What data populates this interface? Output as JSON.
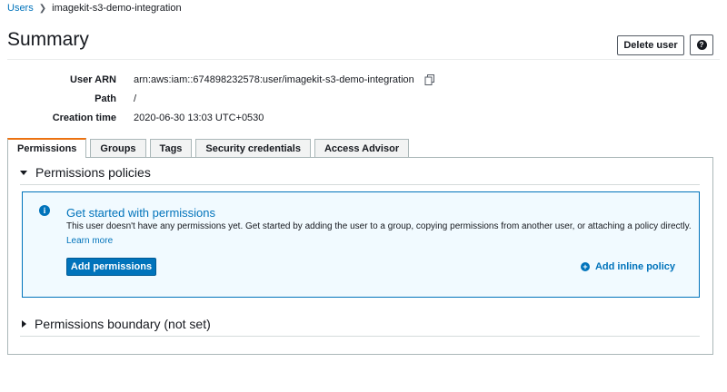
{
  "breadcrumb": {
    "parent": "Users",
    "current": "imagekit-s3-demo-integration"
  },
  "header": {
    "title": "Summary",
    "delete_label": "Delete user",
    "help_glyph": "?"
  },
  "details": {
    "arn_label": "User ARN",
    "arn_value": "arn:aws:iam::674898232578:user/imagekit-s3-demo-integration",
    "path_label": "Path",
    "path_value": "/",
    "created_label": "Creation time",
    "created_value": "2020-06-30 13:03 UTC+0530"
  },
  "tabs": [
    {
      "label": "Permissions",
      "active": true
    },
    {
      "label": "Groups"
    },
    {
      "label": "Tags"
    },
    {
      "label": "Security credentials"
    },
    {
      "label": "Access Advisor"
    }
  ],
  "permissions": {
    "policies_heading": "Permissions policies",
    "info_title": "Get started with permissions",
    "info_text": "This user doesn't have any permissions yet. Get started by adding the user to a group, copying permissions from another user, or attaching a policy directly.",
    "learn_more": "Learn more",
    "add_button": "Add permissions",
    "inline_policy": "Add inline policy",
    "boundary_heading": "Permissions boundary (not set)"
  },
  "colors": {
    "link": "#0073bb",
    "tab_accent": "#ec7211",
    "info_bg": "#f1faff"
  }
}
